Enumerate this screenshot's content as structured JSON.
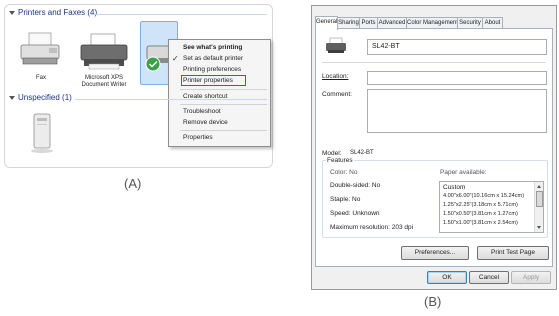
{
  "panel_a": {
    "printers_header": "Printers and Faxes (4)",
    "unspecified_header": "Unspecified (1)",
    "fax_label": "Fax",
    "xps_label_line1": "Microsoft XPS",
    "xps_label_line2": "Document Writer",
    "menu": {
      "see_printing": "See what's printing",
      "set_default": "Set as default printer",
      "printing_prefs": "Printing preferences",
      "printer_props": "Printer properties",
      "create_shortcut": "Create shortcut",
      "troubleshoot": "Troubleshoot",
      "remove_device": "Remove device",
      "properties": "Properties",
      "check": "✓"
    },
    "caption": "(A)",
    "highlight_color": "#d9282f"
  },
  "panel_b": {
    "tabs": [
      "General",
      "Sharing",
      "Ports",
      "Advanced",
      "Color Management",
      "Security",
      "About"
    ],
    "printer_name": "SL42-BT",
    "location_label": "Location:",
    "comment_label": "Comment:",
    "model_label": "Model:",
    "model_value": "SL42-BT",
    "features_label": "Features",
    "color": "Color: No",
    "paper_available": "Paper available:",
    "double_sided": "Double-sided: No",
    "staple": "Staple: No",
    "speed": "Speed: Unknown",
    "max_res": "Maximum resolution: 203 dpi",
    "paper_list": [
      "Custom",
      "4.00\"x6.00\"(10.16cm x 15.24cm)",
      "1.25\"x2.25\"(3.18cm x 5.71cm)",
      "1.50\"x0.50\"(3.81cm x 1.27cm)",
      "1.50\"x1.00\"(3.81cm x 2.54cm)"
    ],
    "preferences_btn": "Preferences...",
    "print_test_btn": "Print Test Page",
    "ok_btn": "OK",
    "cancel_btn": "Cancel",
    "apply_btn": "Apply",
    "caption": "(B)"
  }
}
